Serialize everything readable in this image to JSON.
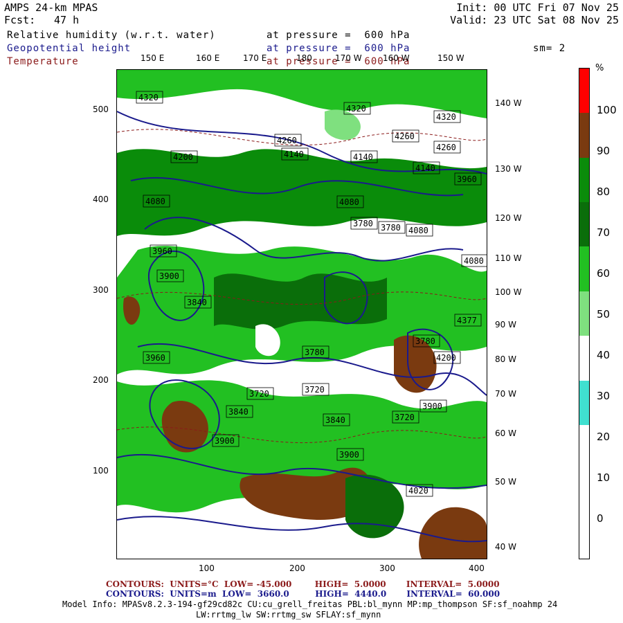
{
  "header": {
    "model": "AMPS 24-km MPAS",
    "fcst_label": "Fcst:",
    "fcst_value": "47 h",
    "init": "Init: 00 UTC Fri 07 Nov 25",
    "valid": "Valid: 23 UTC Sat 08 Nov 25"
  },
  "fields": [
    {
      "name": "Relative humidity (w.r.t. water)",
      "level": "at pressure =  600 hPa",
      "color": "#000000"
    },
    {
      "name": "Geopotential height",
      "level": "at pressure =  600 hPa",
      "color": "#1a1a8c"
    },
    {
      "name": "Temperature",
      "level": "at pressure =  600 hPa",
      "color": "#8b1a1a"
    }
  ],
  "smoothing": "sm= 2",
  "top_longitudes": [
    "150 E",
    "160 E",
    "170 E",
    "180",
    "170 W",
    "160 W",
    "150 W"
  ],
  "right_longitudes": [
    "140 W",
    "130 W",
    "120 W",
    "110 W",
    "100 W",
    "90 W",
    "80 W",
    "70 W",
    "60 W",
    "50 W",
    "40 W"
  ],
  "y_ticks": [
    "500",
    "400",
    "300",
    "200",
    "100"
  ],
  "x_ticks": [
    "100",
    "200",
    "300",
    "400"
  ],
  "colorbar": {
    "unit": "%",
    "labels": [
      "100",
      "90",
      "80",
      "70",
      "60",
      "50",
      "40",
      "30",
      "20",
      "10",
      "0"
    ],
    "bands": [
      {
        "min": 0,
        "max": 30,
        "color": "#ffffff"
      },
      {
        "min": 30,
        "max": 40,
        "color": "#40e0d0"
      },
      {
        "min": 40,
        "max": 50,
        "color": "#ffffff"
      },
      {
        "min": 50,
        "max": 60,
        "color": "#7fe07f"
      },
      {
        "min": 60,
        "max": 70,
        "color": "#22c022"
      },
      {
        "min": 70,
        "max": 80,
        "color": "#0a6e0a"
      },
      {
        "min": 80,
        "max": 90,
        "color": "#0a8c0a"
      },
      {
        "min": 90,
        "max": 100,
        "color": "#7a3a10"
      },
      {
        "min": 100,
        "max": 110,
        "color": "#ff0000"
      }
    ]
  },
  "height_labels": [
    "4320",
    "4320",
    "4320",
    "4260",
    "4260",
    "4260",
    "4200",
    "4140",
    "4140",
    "4140",
    "4080",
    "4080",
    "4080",
    "4080",
    "4020",
    "3960",
    "3960",
    "3900",
    "3900",
    "3900",
    "3840",
    "3840",
    "3840",
    "3780",
    "3780",
    "3780",
    "3720",
    "3720",
    "3720",
    "3960",
    "3900",
    "4200",
    "4377",
    "3780"
  ],
  "footer": {
    "temp_line": "CONTOURS:  UNITS=°C  LOW= -45.000        HIGH=  5.0000       INTERVAL=  5.0000",
    "height_line": "CONTOURS:  UNITS=m  LOW=  3660.0         HIGH=  4440.0       INTERVAL=  60.000",
    "temp_color": "#8b1a1a",
    "height_color": "#1a1a8c",
    "model_info": "Model Info: MPASv8.2.3-194-gf29cd82c CU:cu_grell_freitas PBL:bl_mynn MP:mp_thompson SF:sf_noahmp 24",
    "model_info2": "LW:rrtmg_lw SW:rrtmg_sw SFLAY:sf_mynn"
  }
}
